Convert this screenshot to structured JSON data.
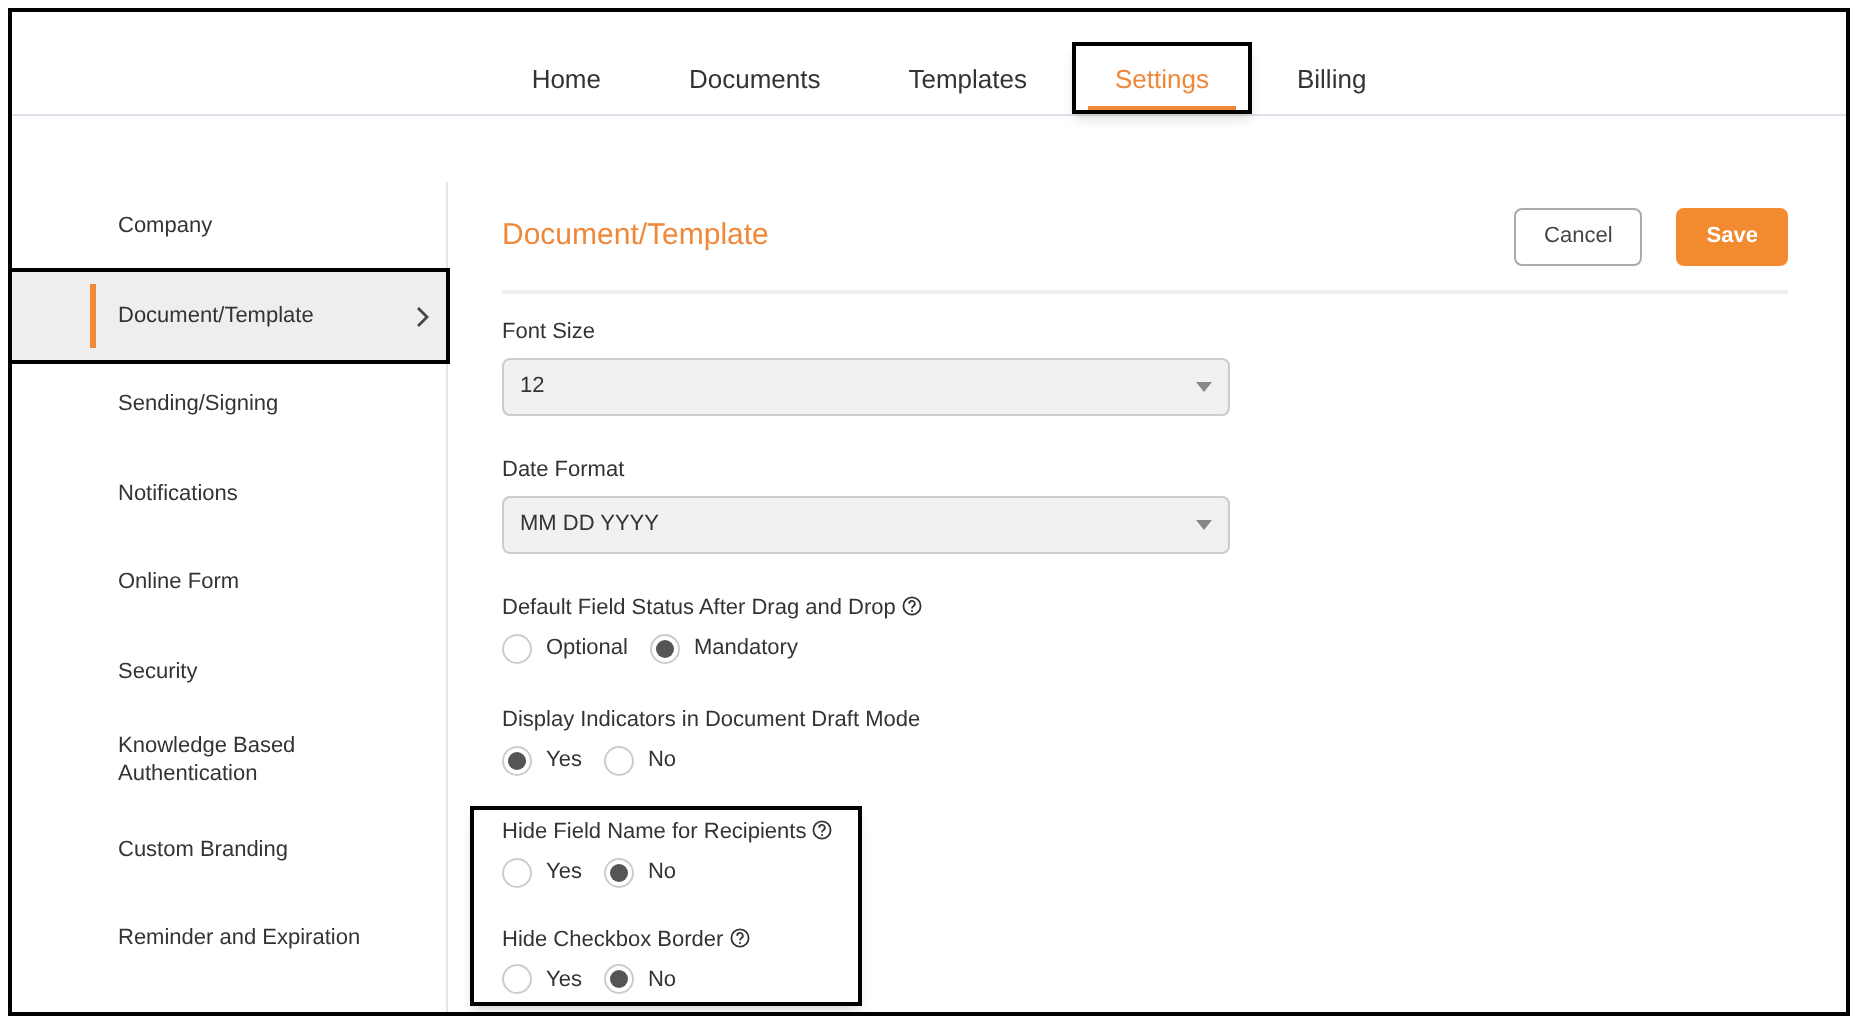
{
  "tabs": [
    {
      "label": "Home",
      "selected": false,
      "highlighted": false
    },
    {
      "label": "Documents",
      "selected": false,
      "highlighted": false
    },
    {
      "label": "Templates",
      "selected": false,
      "highlighted": false
    },
    {
      "label": "Settings",
      "selected": true,
      "highlighted": true
    },
    {
      "label": "Billing",
      "selected": false,
      "highlighted": false
    }
  ],
  "sidebar": {
    "items": [
      {
        "label": "Company",
        "selected": false,
        "highlighted": false
      },
      {
        "label": "Document/Template",
        "selected": true,
        "highlighted": true
      },
      {
        "label": "Sending/Signing",
        "selected": false,
        "highlighted": false
      },
      {
        "label": "Notifications",
        "selected": false,
        "highlighted": false
      },
      {
        "label": "Online Form",
        "selected": false,
        "highlighted": false
      },
      {
        "label": "Security",
        "selected": false,
        "highlighted": false
      },
      {
        "label": "Knowledge Based Authentication",
        "selected": false,
        "highlighted": false
      },
      {
        "label": "Custom Branding",
        "selected": false,
        "highlighted": false
      },
      {
        "label": "Reminder and Expiration",
        "selected": false,
        "highlighted": false
      }
    ]
  },
  "content": {
    "title": "Document/Template",
    "buttons": [
      {
        "label": "Cancel",
        "kind": "secondary"
      },
      {
        "label": "Save",
        "kind": "primary"
      }
    ],
    "fields": [
      {
        "kind": "select",
        "label": "Font Size",
        "value": "12",
        "highlighted": false
      },
      {
        "kind": "select",
        "label": "Date Format",
        "value": "MM DD YYYY",
        "highlighted": false
      },
      {
        "kind": "radio",
        "label": "Default Field Status After Drag and Drop",
        "help": true,
        "highlighted": false,
        "options": [
          {
            "label": "Optional",
            "selected": false
          },
          {
            "label": "Mandatory",
            "selected": true
          }
        ]
      },
      {
        "kind": "radio",
        "label": "Display Indicators in Document Draft Mode",
        "help": false,
        "highlighted": false,
        "options": [
          {
            "label": "Yes",
            "selected": true
          },
          {
            "label": "No",
            "selected": false
          }
        ]
      },
      {
        "kind": "radio",
        "label": "Hide Field Name for Recipients",
        "help": true,
        "highlighted": true,
        "options": [
          {
            "label": "Yes",
            "selected": false
          },
          {
            "label": "No",
            "selected": true
          }
        ]
      },
      {
        "kind": "radio",
        "label": "Hide Checkbox Border",
        "help": true,
        "highlighted": true,
        "options": [
          {
            "label": "Yes",
            "selected": false
          },
          {
            "label": "No",
            "selected": true
          }
        ]
      }
    ]
  }
}
